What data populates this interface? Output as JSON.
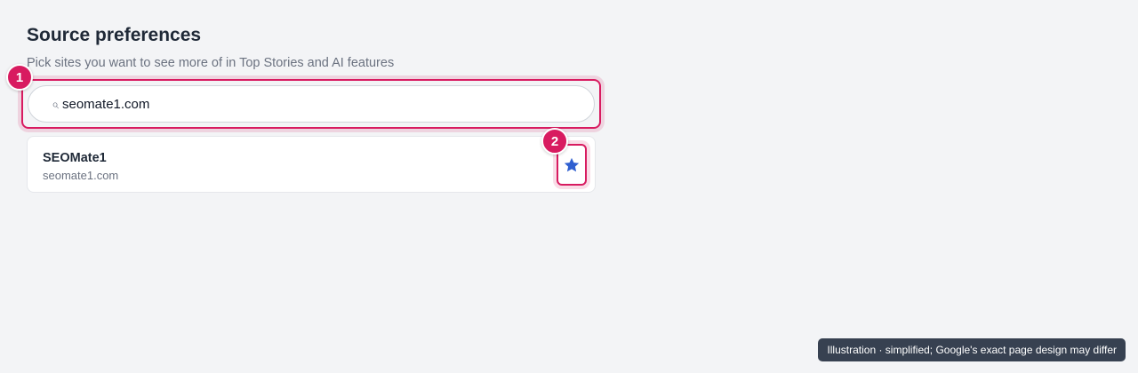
{
  "header": {
    "title": "Source preferences",
    "subtitle": "Pick sites you want to see more of in Top Stories and AI features"
  },
  "search": {
    "icon": "search-icon",
    "value": "seomate1.com",
    "placeholder": ""
  },
  "results": [
    {
      "name": "SEOMate1",
      "domain": "seomate1.com",
      "star_icon": "star-icon",
      "starred": true
    }
  ],
  "callouts": {
    "one": "1",
    "two": "2"
  },
  "footnote": "Illustration · simplified; Google's exact page design may differ",
  "colors": {
    "background": "#f3f4f6",
    "highlight": "#d81b60",
    "star": "#2f5fd0",
    "footnote_bg": "#374151"
  }
}
